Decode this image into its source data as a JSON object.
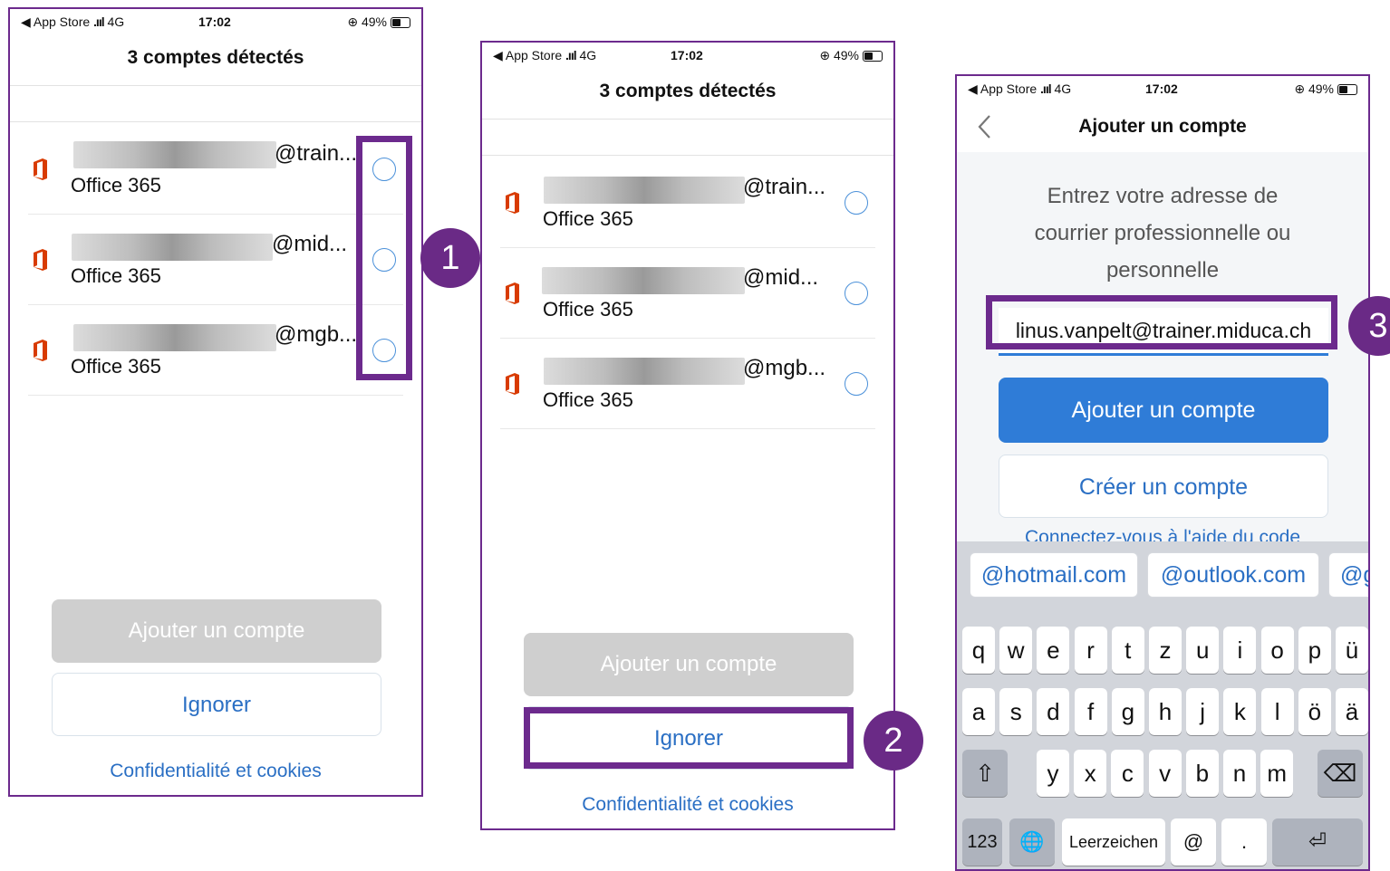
{
  "statusbar": {
    "carrier": "◀ App Store",
    "network": "4G",
    "time": "17:02",
    "battery": "⊕ 49%"
  },
  "screen1": {
    "title": "3 comptes détectés",
    "accounts": [
      {
        "domain": "@train...",
        "type": "Office 365"
      },
      {
        "domain": "@mid...",
        "type": "Office 365"
      },
      {
        "domain": "@mgb...",
        "type": "Office 365"
      }
    ],
    "add_label": "Ajouter un compte",
    "ignore_label": "Ignorer",
    "privacy_label": "Confidentialité et cookies"
  },
  "screen2": {
    "title": "3 comptes détectés",
    "accounts": [
      {
        "domain": "@train...",
        "type": "Office 365"
      },
      {
        "domain": "@mid...",
        "type": "Office 365"
      },
      {
        "domain": "@mgb...",
        "type": "Office 365"
      }
    ],
    "add_label": "Ajouter un compte",
    "ignore_label": "Ignorer",
    "privacy_label": "Confidentialité et cookies"
  },
  "screen3": {
    "title": "Ajouter un compte",
    "prompt_lines": [
      "Entrez votre adresse de",
      "courrier professionnelle ou",
      "personnelle"
    ],
    "email_value": "linus.vanpelt@trainer.miduca.ch",
    "add_label": "Ajouter un compte",
    "create_label": "Créer un compte",
    "code_link": "Connectez-vous à l'aide du code",
    "suggestions": [
      "@hotmail.com",
      "@outlook.com",
      "@g"
    ],
    "keyboard": {
      "row1": [
        "q",
        "w",
        "e",
        "r",
        "t",
        "z",
        "u",
        "i",
        "o",
        "p",
        "ü"
      ],
      "row2": [
        "a",
        "s",
        "d",
        "f",
        "g",
        "h",
        "j",
        "k",
        "l",
        "ö",
        "ä"
      ],
      "row3": [
        "y",
        "x",
        "c",
        "v",
        "b",
        "n",
        "m"
      ],
      "numbers_key": "123",
      "space_key": "Leerzeichen",
      "at_key": "@",
      "dot_key": ".",
      "shift_icon": "⇧",
      "delete_icon": "⌫",
      "globe_icon": "🌐",
      "return_icon": "⏎"
    }
  },
  "badges": [
    "1",
    "2",
    "3"
  ],
  "colors": {
    "accent_purple": "#6c2a8d",
    "link_blue": "#2a6fc4",
    "primary_blue": "#2f7cd7"
  }
}
